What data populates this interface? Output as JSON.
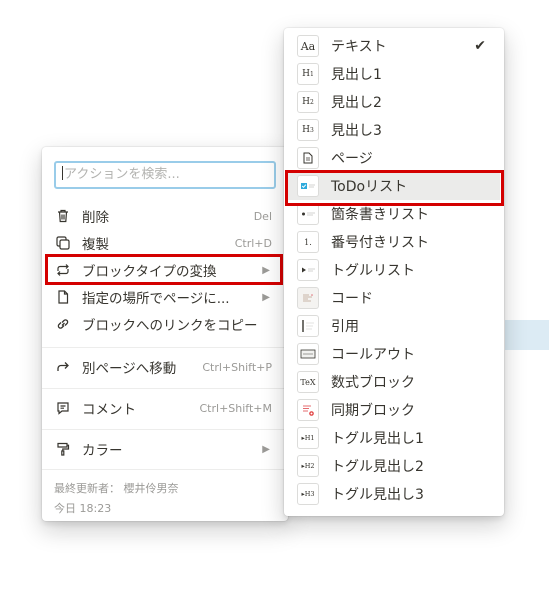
{
  "left_menu": {
    "search_placeholder": "アクションを検索...",
    "items": [
      {
        "label": "削除",
        "shortcut": "Del",
        "icon": "trash-icon"
      },
      {
        "label": "複製",
        "shortcut": "Ctrl+D",
        "icon": "duplicate-icon"
      },
      {
        "label": "ブロックタイプの変換",
        "arrow": "▶",
        "icon": "turn-into-icon"
      },
      {
        "label": "指定の場所でページに...",
        "arrow": "▶",
        "icon": "page-icon"
      },
      {
        "label": "ブロックへのリンクをコピー",
        "icon": "link-icon"
      },
      {
        "label": "別ページへ移動",
        "shortcut": "Ctrl+Shift+P",
        "icon": "move-arrow-icon"
      },
      {
        "label": "コメント",
        "shortcut": "Ctrl+Shift+M",
        "icon": "comment-icon"
      },
      {
        "label": "カラー",
        "arrow": "▶",
        "icon": "paint-roller-icon"
      }
    ],
    "footer": {
      "edited_by_label": "最終更新者： 櫻井伶男奈",
      "edited_time": "今日 18:23"
    }
  },
  "right_menu": {
    "items": [
      {
        "label": "テキスト",
        "thumb": "Aa",
        "checked": "✔"
      },
      {
        "label": "見出し1",
        "thumb": "H1"
      },
      {
        "label": "見出し2",
        "thumb": "H2"
      },
      {
        "label": "見出し3",
        "thumb": "H3"
      },
      {
        "label": "ページ",
        "thumb": "page"
      },
      {
        "label": "ToDoリスト",
        "thumb": "todo"
      },
      {
        "label": "箇条書きリスト",
        "thumb": "bullet"
      },
      {
        "label": "番号付きリスト",
        "thumb": "1."
      },
      {
        "label": "トグルリスト",
        "thumb": "toggle"
      },
      {
        "label": "コード",
        "thumb": "code"
      },
      {
        "label": "引用",
        "thumb": "quote"
      },
      {
        "label": "コールアウト",
        "thumb": "callout"
      },
      {
        "label": "数式ブロック",
        "thumb": "TeX"
      },
      {
        "label": "同期ブロック",
        "thumb": "sync"
      },
      {
        "label": "トグル見出し1",
        "thumb": "▸H1"
      },
      {
        "label": "トグル見出し2",
        "thumb": "▸H2"
      },
      {
        "label": "トグル見出し3",
        "thumb": "▸H3"
      }
    ]
  },
  "colors": {
    "highlight_box": "#d40000",
    "search_border": "#99cce9",
    "selected_row": "#ebebea",
    "todo_check": "#2eaadc"
  }
}
